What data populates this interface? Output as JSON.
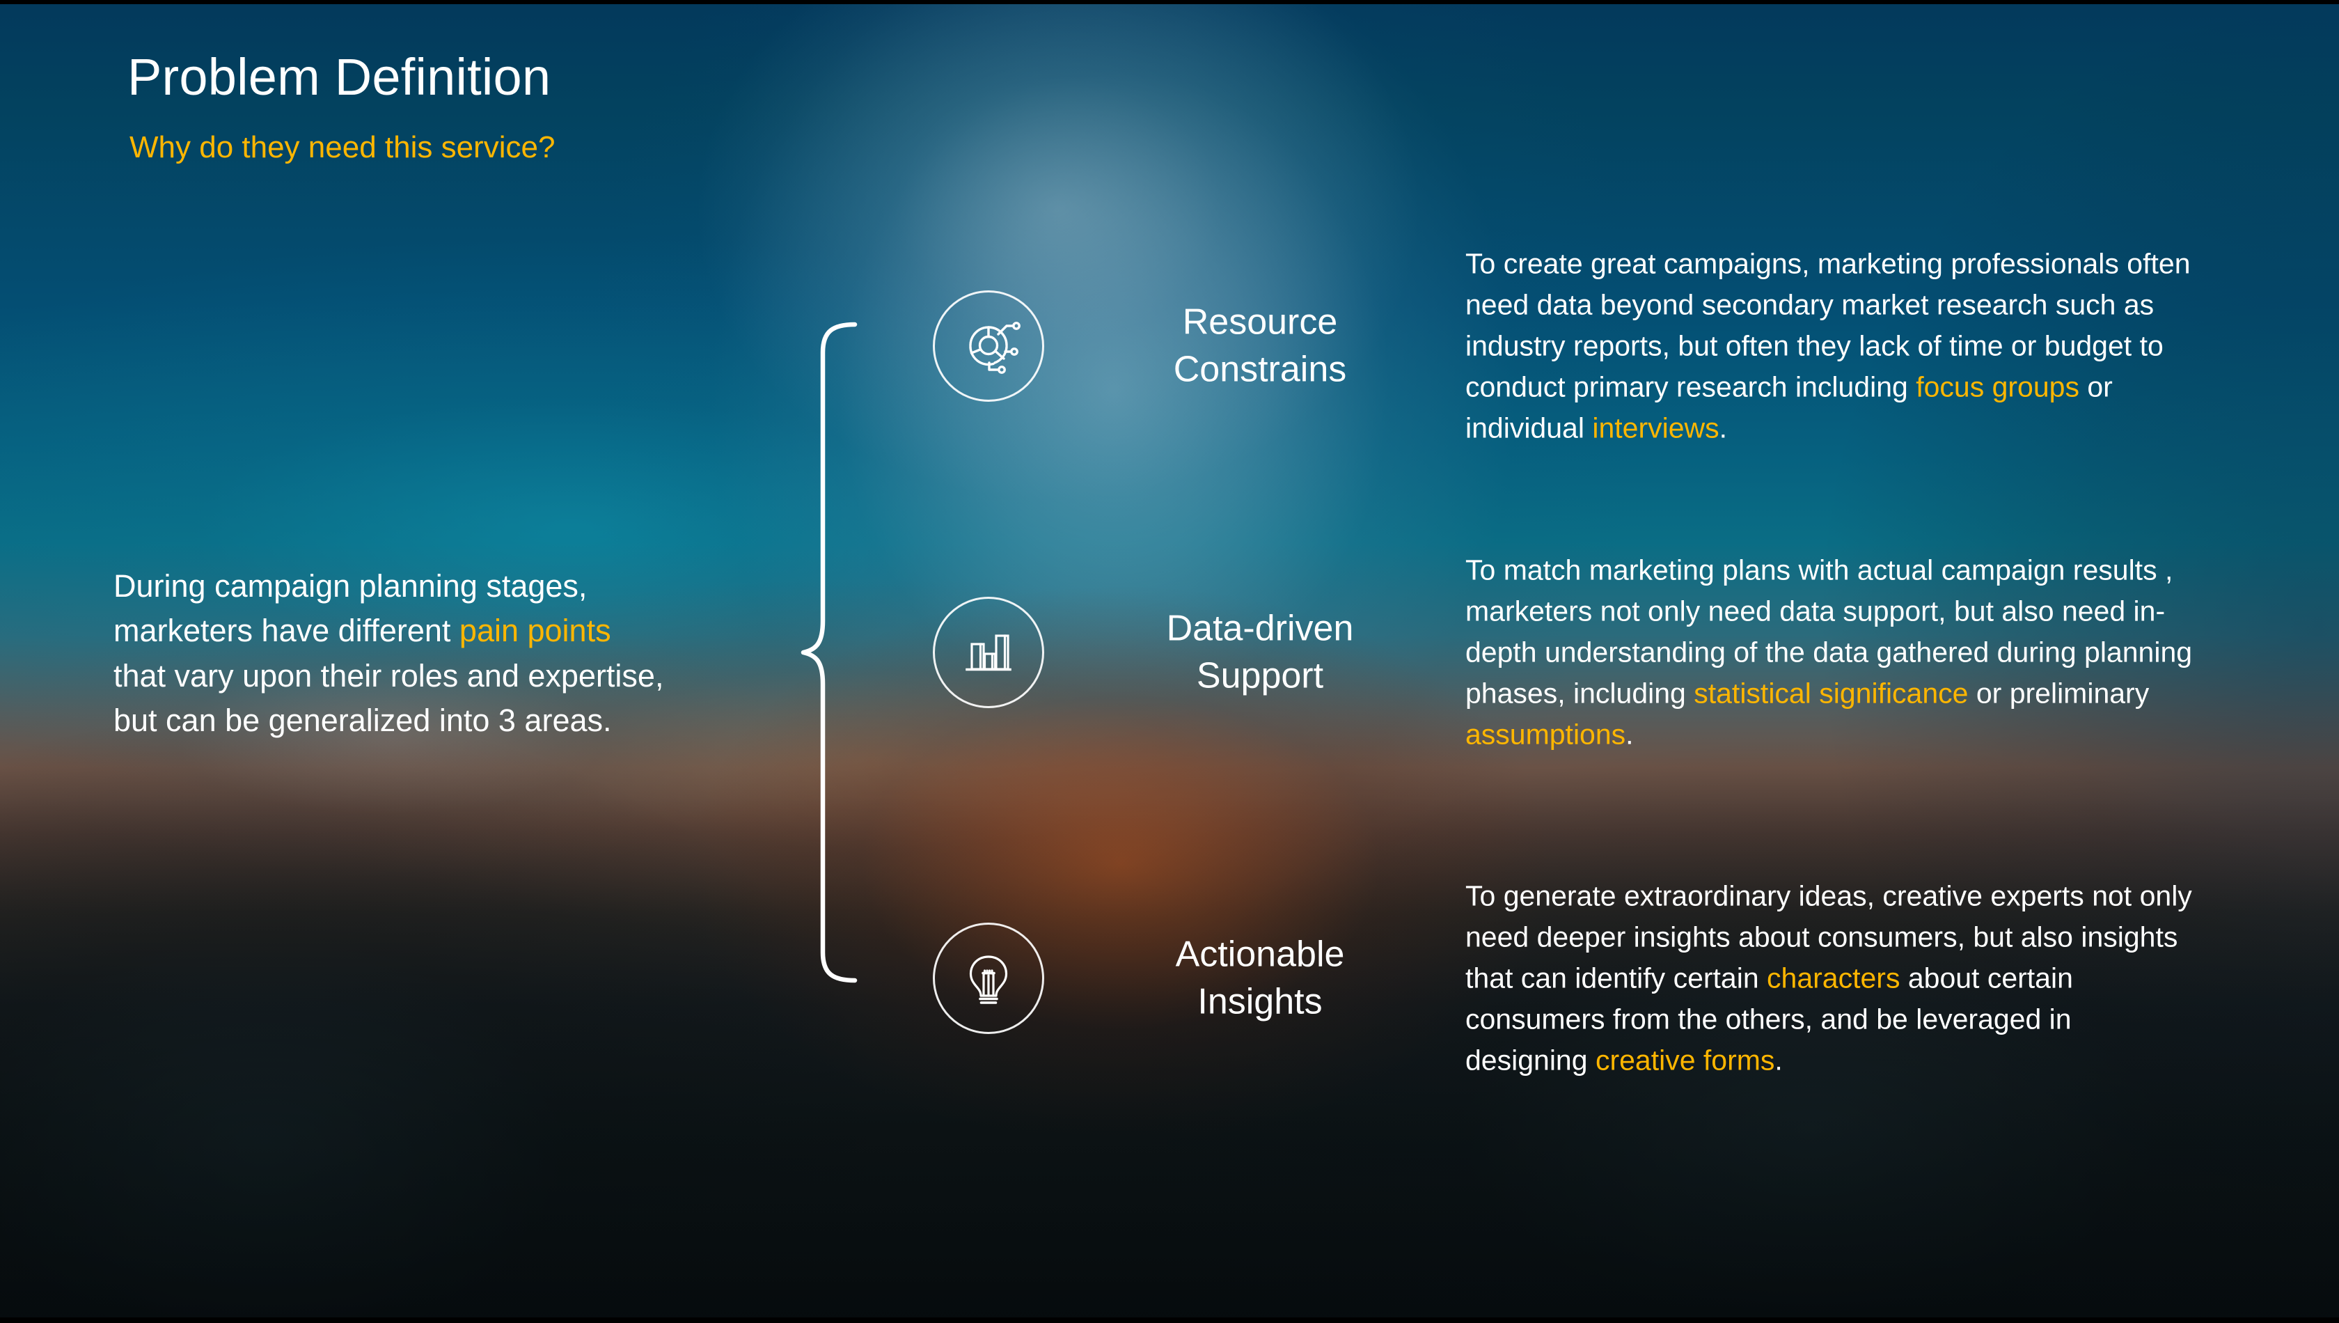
{
  "slide": {
    "title": "Problem Definition",
    "subtitle": "Why do they need this service?",
    "accent_color": "#FFB600",
    "text_color": "#FFFFFF"
  },
  "intro": {
    "line1": "During campaign planning stages,",
    "line2_pre": "marketers have different ",
    "line2_hl": "pain points",
    "line3": "that vary upon their roles and expertise,",
    "line4": "but can be generalized into 3 areas."
  },
  "bracket": {
    "icon": "curly-brace",
    "groups": 3
  },
  "rows": [
    {
      "icon": "network-analytics-icon",
      "label_line1": "Resource",
      "label_line2": "Constrains",
      "body_parts": [
        {
          "text": "To create great campaigns, marketing professionals often need data beyond secondary market research such as industry reports, but often they lack of time or budget to conduct primary research including ",
          "highlight": false
        },
        {
          "text": "focus groups",
          "highlight": true
        },
        {
          "text": " or individual ",
          "highlight": false
        },
        {
          "text": "interviews",
          "highlight": true
        },
        {
          "text": ".",
          "highlight": false
        }
      ]
    },
    {
      "icon": "bar-chart-icon",
      "label_line1": "Data-driven",
      "label_line2": "Support",
      "body_parts": [
        {
          "text": "To match marketing plans with actual campaign results , marketers not only need data support, but also need in-depth understanding of the data gathered during planning phases, including ",
          "highlight": false
        },
        {
          "text": "statistical significance",
          "highlight": true
        },
        {
          "text": " or preliminary ",
          "highlight": false
        },
        {
          "text": "assumptions",
          "highlight": true
        },
        {
          "text": ".",
          "highlight": false
        }
      ]
    },
    {
      "icon": "lightbulb-icon",
      "label_line1": "Actionable",
      "label_line2": "Insights",
      "body_parts": [
        {
          "text": "To generate extraordinary ideas, creative experts not only need deeper insights about consumers, but also insights that can identify certain ",
          "highlight": false
        },
        {
          "text": "characters",
          "highlight": true
        },
        {
          "text": " about certain consumers from the others, and be leveraged in designing ",
          "highlight": false
        },
        {
          "text": "creative forms",
          "highlight": true
        },
        {
          "text": ".",
          "highlight": false
        }
      ]
    }
  ]
}
